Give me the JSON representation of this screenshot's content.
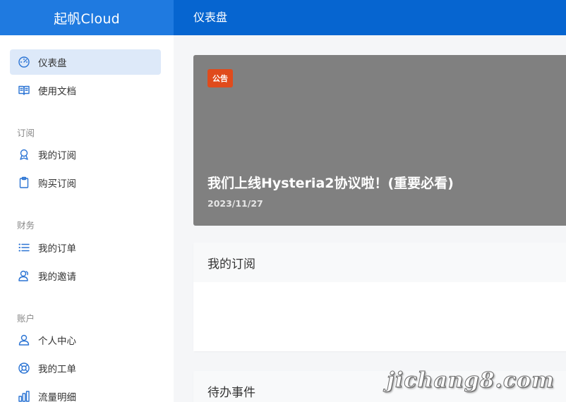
{
  "header": {
    "brand": "起帆Cloud",
    "page_title": "仪表盘"
  },
  "sidebar": {
    "items": [
      {
        "label": "仪表盘",
        "icon": "dashboard-icon",
        "active": true
      },
      {
        "label": "使用文档",
        "icon": "book-icon"
      }
    ],
    "sections": [
      {
        "title": "订阅",
        "items": [
          {
            "label": "我的订阅",
            "icon": "award-icon"
          },
          {
            "label": "购买订阅",
            "icon": "clipboard-icon"
          }
        ]
      },
      {
        "title": "财务",
        "items": [
          {
            "label": "我的订单",
            "icon": "list-icon"
          },
          {
            "label": "我的邀请",
            "icon": "users-icon"
          }
        ]
      },
      {
        "title": "账户",
        "items": [
          {
            "label": "个人中心",
            "icon": "user-icon"
          },
          {
            "label": "我的工单",
            "icon": "lifebuoy-icon"
          },
          {
            "label": "流量明细",
            "icon": "bar-chart-icon"
          }
        ]
      }
    ]
  },
  "announcement": {
    "badge": "公告",
    "title": "我们上线Hysteria2协议啦！(重要必看)",
    "date": "2023/11/27",
    "background_color": "#808080",
    "badge_color": "#e04b1c"
  },
  "cards": [
    {
      "title": "我的订阅"
    },
    {
      "title": "待办事件"
    }
  ],
  "watermark": "jichang8.com",
  "colors": {
    "header": "#0665d0",
    "brand_bg": "#1f7ae0",
    "active_item_bg": "#dde9f9",
    "icon": "#2b74d4"
  }
}
